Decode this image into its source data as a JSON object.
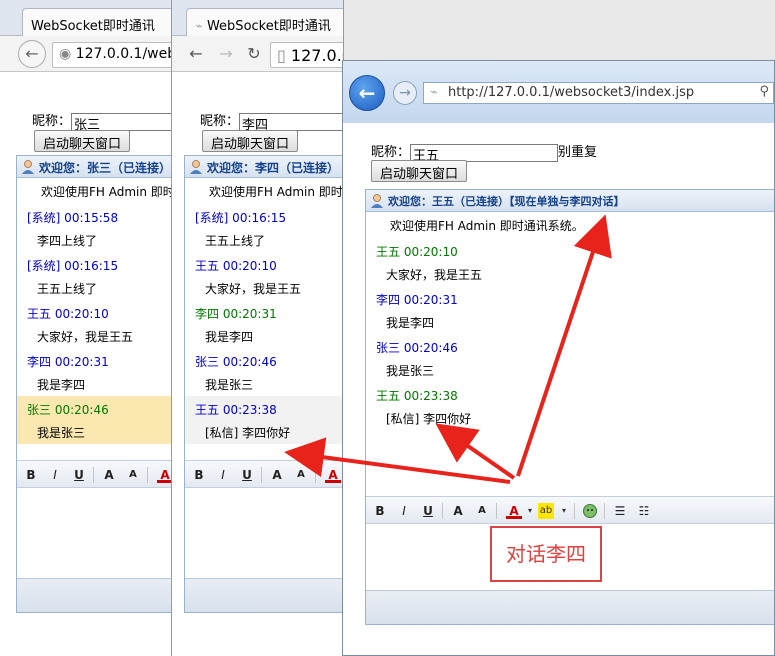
{
  "window1": {
    "tab_title": "WebSocket即时通讯",
    "url": "127.0.0.1/websoc",
    "nick_label": "昵称：",
    "nick_value": "张三",
    "start_button": "启动聊天窗口",
    "panel_title": "欢迎您：张三（已连接）【",
    "welcome": "欢迎使用FH Admin 即时",
    "messages": [
      {
        "head": "[系统] 00:15:58",
        "body": "李四上线了",
        "color": "blue"
      },
      {
        "head": "[系统] 00:16:15",
        "body": "王五上线了",
        "color": "blue"
      },
      {
        "head": "王五 00:20:10",
        "body": "大家好，我是王五",
        "color": "blue"
      },
      {
        "head": "李四 00:20:31",
        "body": "我是李四",
        "color": "blue"
      },
      {
        "head": "张三 00:20:46",
        "body": "我是张三",
        "color": "green",
        "highlight": true
      }
    ]
  },
  "window2": {
    "tab_title": "WebSocket即时通讯",
    "url": "127.0.0.1",
    "nick_label": "昵称：",
    "nick_value": "李四",
    "start_button": "启动聊天窗口",
    "panel_title": "欢迎您：李四（已连接）",
    "welcome": "欢迎使用FH Admin 即时",
    "messages": [
      {
        "head": "[系统] 00:16:15",
        "body": "王五上线了",
        "color": "blue"
      },
      {
        "head": "王五 00:20:10",
        "body": "大家好，我是王五",
        "color": "blue"
      },
      {
        "head": "李四 00:20:31",
        "body": "我是李四",
        "color": "green"
      },
      {
        "head": "张三 00:20:46",
        "body": "我是张三",
        "color": "blue"
      },
      {
        "head": "王五 00:23:38",
        "body": "[私信] 李四你好",
        "color": "blue",
        "highlight": true
      }
    ]
  },
  "window3": {
    "url": "http://127.0.0.1/websocket3/index.jsp",
    "nick_label": "昵称：",
    "nick_value": "王五",
    "nick_suffix": "别重复",
    "start_button": "启动聊天窗口",
    "panel_title": "欢迎您：王五（已连接）【现在单独与李四对话】",
    "welcome": "欢迎使用FH Admin 即时通讯系统。",
    "messages": [
      {
        "head": "王五 00:20:10",
        "body": "大家好，我是王五",
        "color": "green"
      },
      {
        "head": "李四 00:20:31",
        "body": "我是李四",
        "color": "blue"
      },
      {
        "head": "张三 00:20:46",
        "body": "我是张三",
        "color": "blue"
      },
      {
        "head": "王五 00:23:38",
        "body": "[私信] 李四你好",
        "color": "green"
      }
    ]
  },
  "toolbar": {
    "bold": "B",
    "italic": "I",
    "underline": "U",
    "font_up": "A",
    "font_down": "A",
    "font_color": "A",
    "highlight": "ab"
  },
  "callout": "对话李四",
  "colors": {
    "blue": "#0000cc",
    "green": "#007700",
    "arrow": "#e8231c",
    "highlight_row": "#fbe7b0"
  }
}
